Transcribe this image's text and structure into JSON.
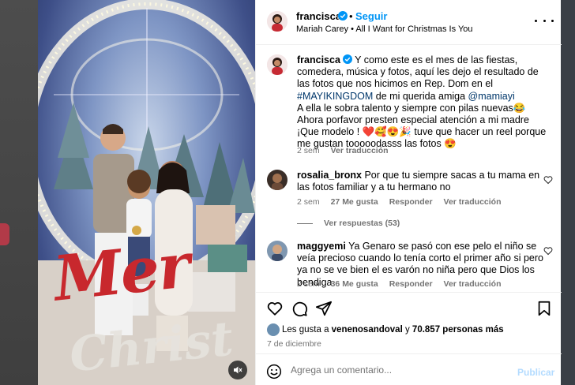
{
  "header": {
    "username": "francisca",
    "separator": "•",
    "follow_label": "Seguir",
    "song": "Mariah Carey • All I Want for Christmas Is You"
  },
  "caption": {
    "username": "francisca",
    "line1": "Y como este es el mes de las fiestas, comedera, música y fotos, aquí les dejo el resultado de las fotos que nos hicimos en Rep. Dom en el ",
    "hashtag": "#MAYIKINGDOM",
    "line1b": " de mi querida amiga ",
    "mention": "@mamiayi",
    "line2": "A ella le sobra talento y siempre con pilas nuevas😂",
    "line3": "Ahora porfavor presten especial atención a mi madre",
    "line4": "¡Que modelo ! ❤️🥰😍🎉 tuve que hacer un reel porque me gustan tooooodasss las fotos 😍",
    "time": "2 sem",
    "translate": "Ver traducción"
  },
  "comments": [
    {
      "username": "rosalia_bronx",
      "text": "Por que tu siempre sacas a tu mama en las fotos familiar y a tu hermano no",
      "time": "2 sem",
      "likes": "27 Me gusta",
      "reply": "Responder",
      "translate": "Ver traducción",
      "view_replies": "Ver respuestas (53)"
    },
    {
      "username": "maggyemi",
      "text": "Ya Genaro se pasó con ese pelo el niño se veía precioso cuando lo tenía corto el primer año si pero ya no se ve bien el es varón no niña pero que Dios los bendiga",
      "time": "2 sem",
      "likes": "36 Me gusta",
      "reply": "Responder",
      "translate": "Ver traducción"
    }
  ],
  "likes": {
    "prefix": "Les gusta a ",
    "user": "venenosandoval",
    "middle": " y ",
    "count": "70.857 personas más"
  },
  "date": "7 de diciembre",
  "composer": {
    "placeholder": "Agrega un comentario...",
    "publish_label": "Publicar"
  },
  "image_text": {
    "merry": "Mer",
    "christmas": "Christ"
  },
  "colors": {
    "link_blue": "#0095f6",
    "hashtag_blue": "#00376b",
    "secondary_gray": "#737373",
    "publish_disabled": "#b3dbff",
    "merry_red": "#c8282d"
  }
}
